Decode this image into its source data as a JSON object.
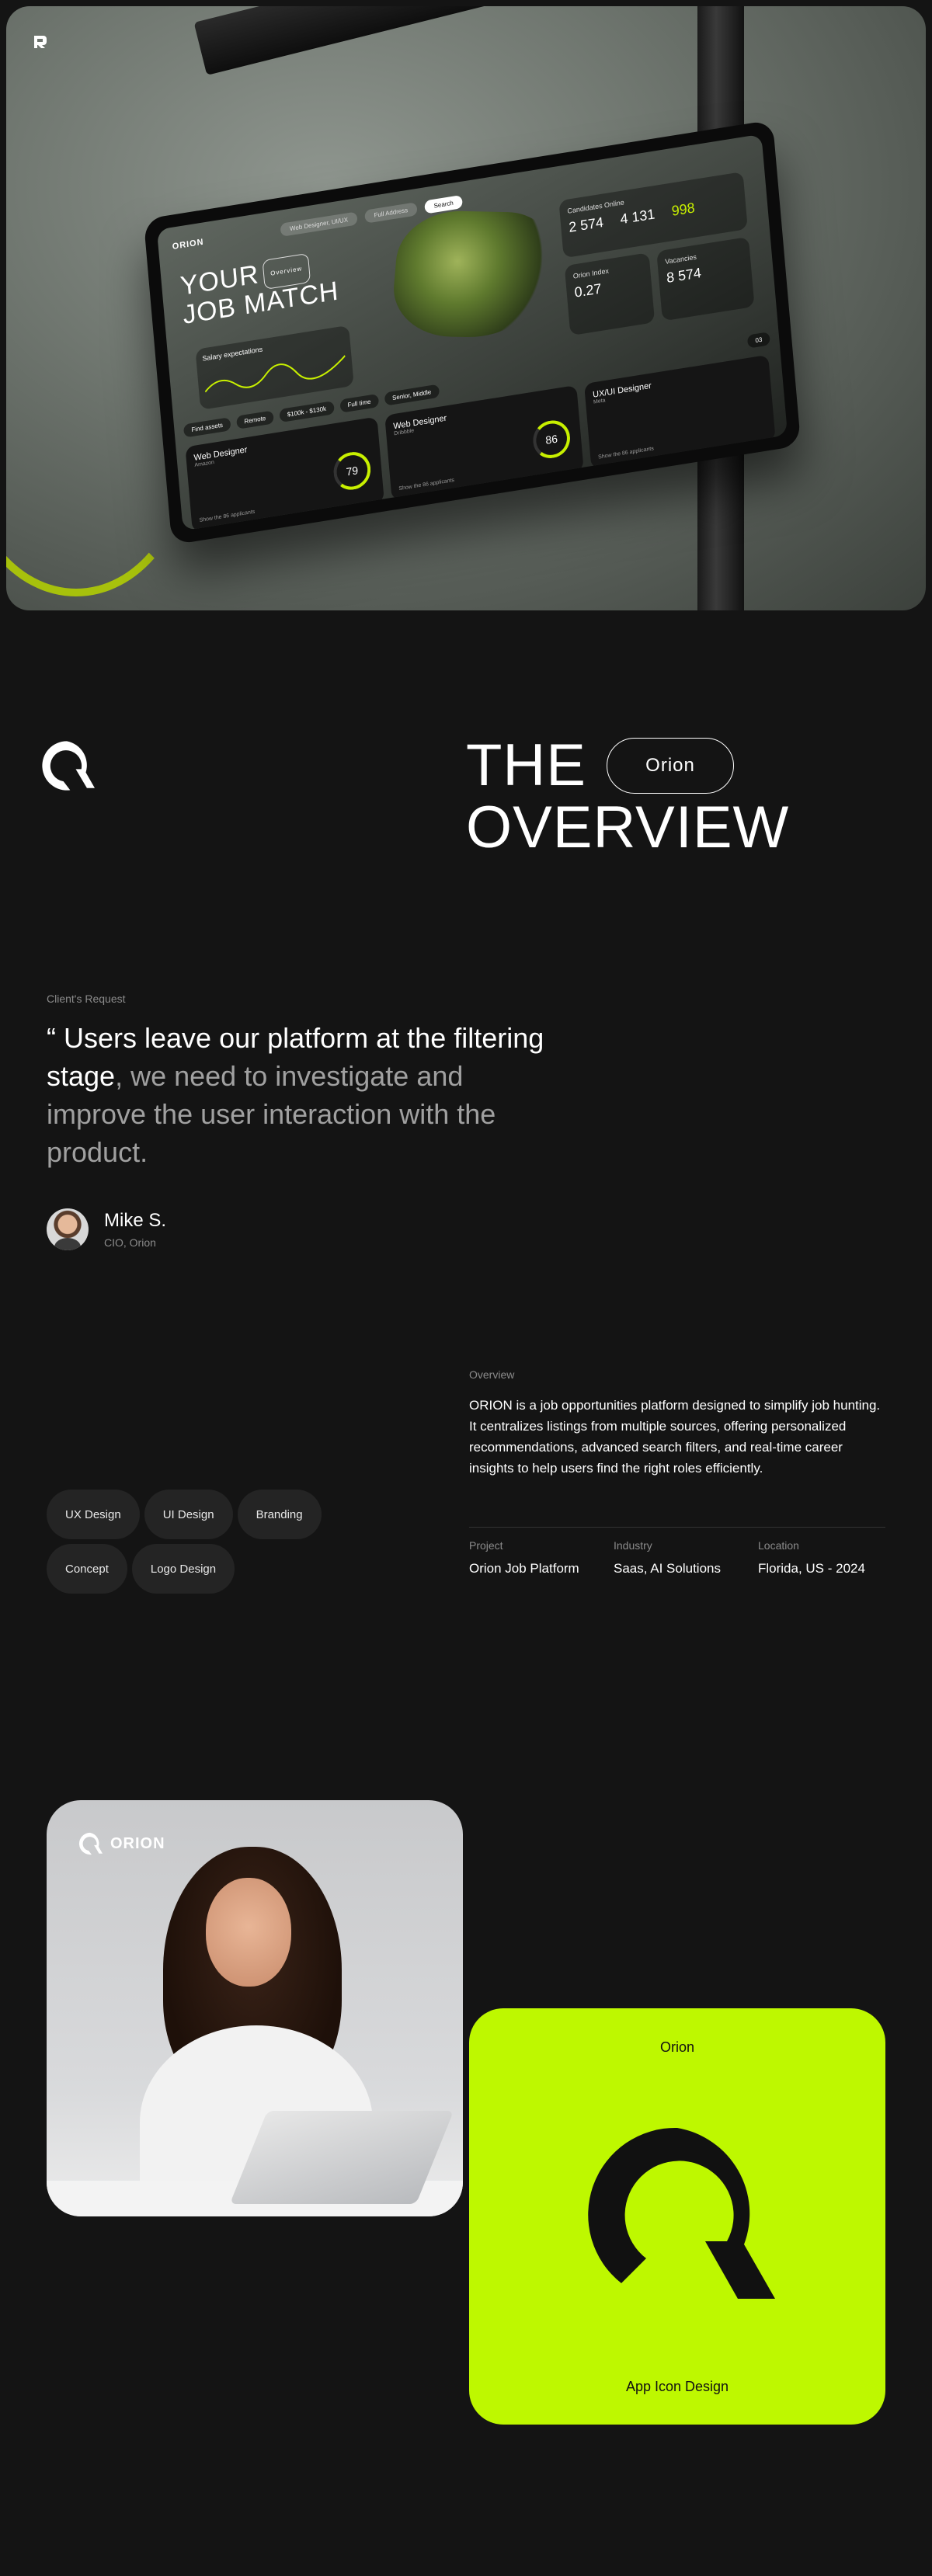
{
  "hero": {
    "screen": {
      "logo": "ORION",
      "search_role": "Web Designer, UI/UX",
      "search_location": "Full Address",
      "search_button": "Search",
      "title_line1": "YOUR",
      "title_line2": "JOB MATCH",
      "title_chip": "Overview",
      "salary_label": "Salary expectations",
      "candidates_label": "Candidates Online",
      "candidates_values": [
        "2 574",
        "4 131",
        "998"
      ],
      "index_label": "Orion Index",
      "index_value": "0.27",
      "vacancies_label": "Vacancies",
      "vacancies_value": "8 574",
      "filters": [
        "Find assets",
        "Remote",
        "$100k - $130k",
        "Full time",
        "Senior, Middle"
      ],
      "pager": "03",
      "jobs": [
        {
          "title": "Web Designer",
          "company": "Amazon",
          "score": "79",
          "footer": "Show the 86 applicants"
        },
        {
          "title": "Web Designer",
          "company": "Dribbble",
          "score": "86",
          "footer": "Show the 86 applicants"
        },
        {
          "title": "UX/UI Designer",
          "company": "Meta",
          "score": "",
          "footer": "Show the 86 applicants"
        }
      ]
    }
  },
  "overview": {
    "title_line1": "THE",
    "title_line2": "OVERVIEW",
    "tag": "Orion",
    "client_label": "Client's Request",
    "quote_strong": "“ Users leave our platform at the filtering stage",
    "quote_rest": ", we need to investigate and improve the user interaction with the product.",
    "author_name": "Mike S.",
    "author_role": "CIO, Orion",
    "overview_label": "Overview",
    "overview_text": "ORION is a job opportunities platform designed to simplify job hunting. It centralizes listings from multiple sources, offering personalized recommendations, advanced search filters, and real-time career insights to help users find the right roles efficiently.",
    "meta": [
      {
        "key": "Project",
        "value": "Orion Job Platform"
      },
      {
        "key": "Industry",
        "value": "Saas, AI Solutions"
      },
      {
        "key": "Location",
        "value": "Florida, US - 2024"
      }
    ],
    "tags": [
      "UX Design",
      "UI Design",
      "Branding",
      "Concept",
      "Logo Design"
    ]
  },
  "gallery": {
    "photo_brand": "ORION",
    "app_title": "Orion",
    "app_caption": "App Icon Design"
  },
  "colors": {
    "accent": "#bef800",
    "background": "#141414",
    "muted": "#8b8b8b"
  }
}
